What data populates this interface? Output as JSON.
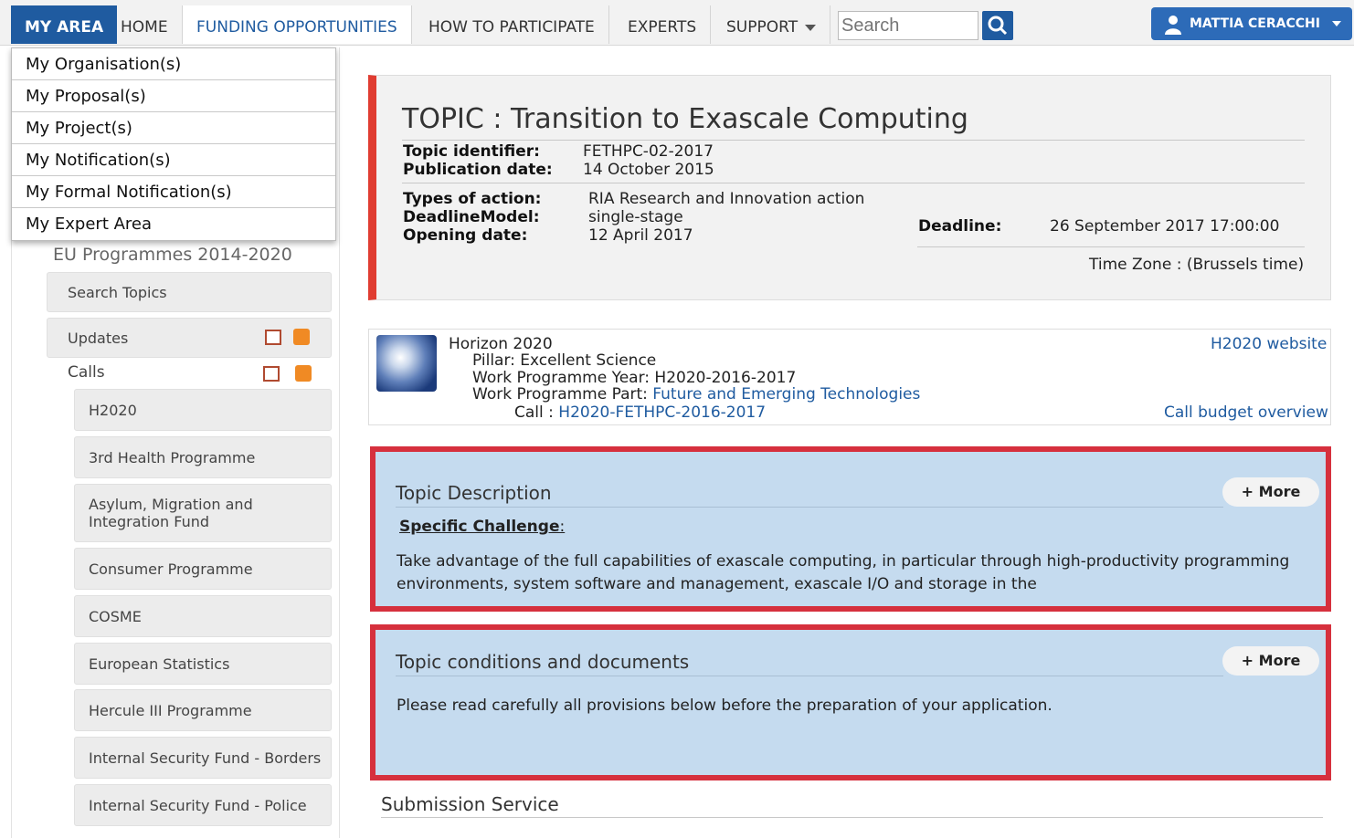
{
  "nav": {
    "my_area": "MY AREA",
    "home": "HOME",
    "funding": "FUNDING OPPORTUNITIES",
    "participate": "HOW TO PARTICIPATE",
    "experts": "EXPERTS",
    "support": "SUPPORT",
    "search_placeholder": "Search",
    "user": "MATTIA CERACCHI"
  },
  "dropdown": [
    "My Organisation(s)",
    "My Proposal(s)",
    "My Project(s)",
    "My Notification(s)",
    "My Formal Notification(s)",
    "My Expert Area"
  ],
  "sidebar": {
    "title": "EU Programmes 2014-2020",
    "search_topics": "Search Topics",
    "updates": "Updates",
    "calls": "Calls",
    "items": [
      "H2020",
      "3rd Health Programme",
      "Asylum, Migration and Integration Fund",
      "Consumer Programme",
      "COSME",
      "European Statistics",
      "Hercule III Programme",
      "Internal Security Fund - Borders",
      "Internal Security Fund - Police"
    ]
  },
  "topic": {
    "title": "TOPIC : Transition to Exascale Computing",
    "identifier_label": "Topic identifier:",
    "identifier": "FETHPC-02-2017",
    "pubdate_label": "Publication date:",
    "pubdate": "14 October 2015",
    "types_label": "Types of action:",
    "types": "RIA Research and Innovation action",
    "model_label": "DeadlineModel:",
    "model": "single-stage",
    "opening_label": "Opening date:",
    "opening": "12 April 2017",
    "deadline_label": "Deadline:",
    "deadline": "26 September 2017 17:00:00",
    "timezone": "Time Zone : (Brussels time)"
  },
  "programme": {
    "name": "Horizon 2020",
    "pillar": "Pillar: Excellent Science",
    "wp_year": "Work Programme Year: H2020-2016-2017",
    "wp_part_label": "Work Programme Part:",
    "wp_part": "Future and Emerging Technologies",
    "call_label": "Call :",
    "call": "H2020-FETHPC-2016-2017",
    "website": "H2020 website",
    "budget": "Call budget overview"
  },
  "description": {
    "heading": "Topic Description",
    "more": "+ More",
    "challenge": "Specific Challenge",
    "text": "Take advantage of the full capabilities of exascale computing, in particular through high-productivity programming environments, system software and management, exascale I/O and storage in the"
  },
  "conditions": {
    "heading": "Topic conditions and documents",
    "more": "+ More",
    "text": "Please read carefully all provisions below before the preparation of your application."
  },
  "submission": "Submission Service"
}
